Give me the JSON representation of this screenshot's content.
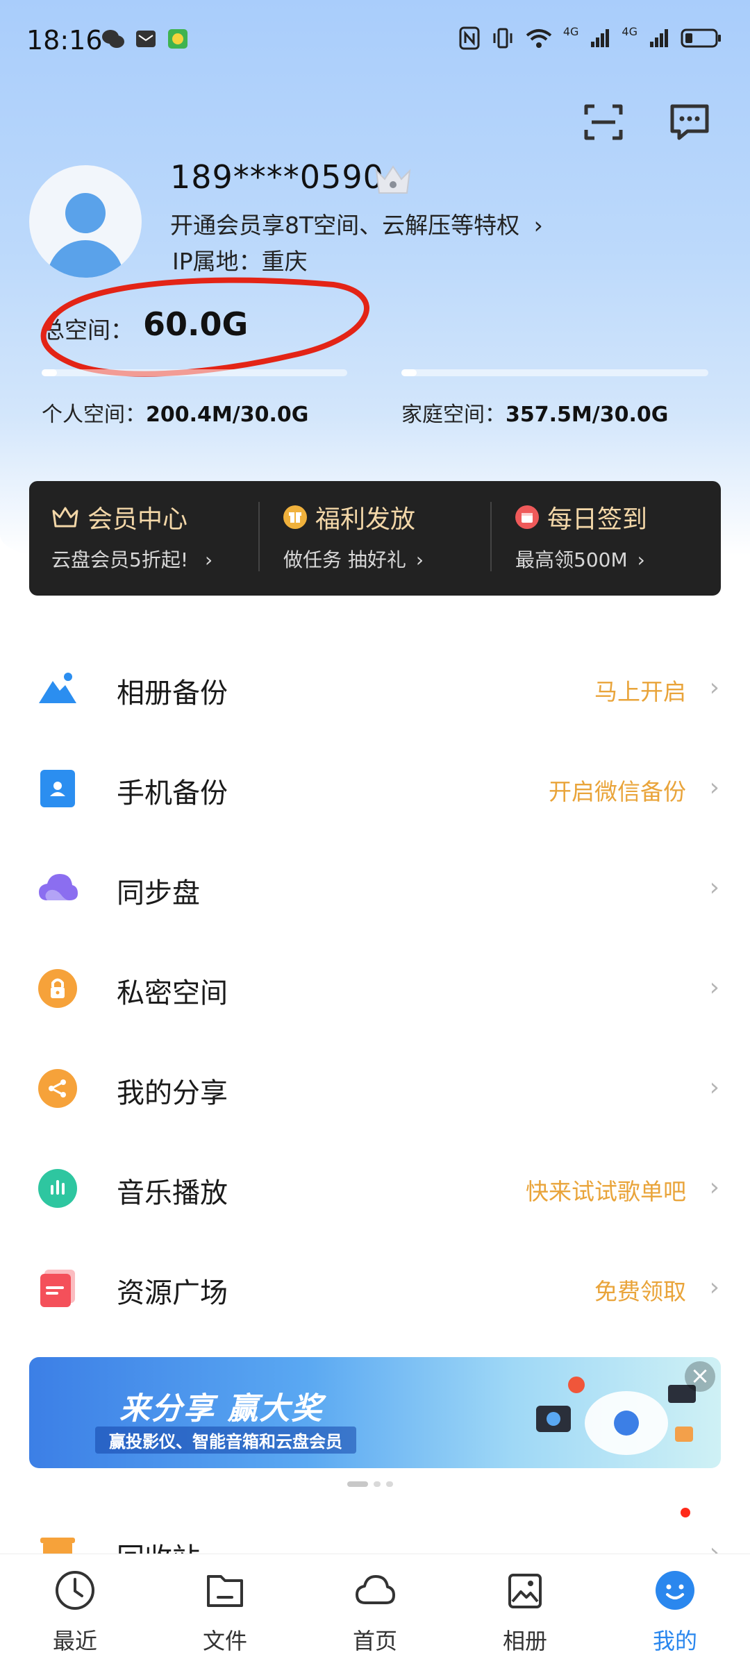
{
  "status_bar": {
    "time": "18:16",
    "net1": "4G",
    "net2": "4G"
  },
  "profile": {
    "phone": "189****0590",
    "promo": "开通会员享8T空间、云解压等特权",
    "promo_chevron": "›",
    "ip_location": "IP属地：重庆",
    "total_label": "总空间：",
    "total_value": "60.0G"
  },
  "storage": {
    "personal_label": "个人空间：",
    "personal_value": "200.4M/30.0G",
    "personal_fraction": 0.0065,
    "family_label": "家庭空间：",
    "family_value": "357.5M/30.0G",
    "family_fraction": 0.0116
  },
  "vip_card": {
    "items": [
      {
        "title": "会员中心",
        "sub": "云盘会员5折起!",
        "icon": "crown-icon"
      },
      {
        "title": "福利发放",
        "sub": "做任务 抽好礼",
        "icon": "gift-icon"
      },
      {
        "title": "每日签到",
        "sub": "最高领500M",
        "icon": "calendar-icon"
      }
    ],
    "chevron": "›"
  },
  "menu": [
    {
      "label": "相册备份",
      "extra": "马上开启",
      "icon": "mountain-icon",
      "color": "#2b8ef0"
    },
    {
      "label": "手机备份",
      "extra": "开启微信备份",
      "icon": "contact-icon",
      "color": "#2b8ef0"
    },
    {
      "label": "同步盘",
      "extra": "",
      "icon": "cloud-icon",
      "color": "#8b6ef0"
    },
    {
      "label": "私密空间",
      "extra": "",
      "icon": "lock-icon",
      "color": "#f6a23a"
    },
    {
      "label": "我的分享",
      "extra": "",
      "icon": "share-icon",
      "color": "#f6a23a"
    },
    {
      "label": "音乐播放",
      "extra": "快来试试歌单吧",
      "icon": "music-bars-icon",
      "color": "#2ec6a0"
    },
    {
      "label": "资源广场",
      "extra": "免费领取",
      "icon": "resource-icon",
      "color": "#f4505a"
    },
    {
      "label": "回收站",
      "extra": "",
      "icon": "recycle-icon",
      "color": "#f6a23a"
    }
  ],
  "menu_chevron": "›",
  "banner": {
    "title": "来分享 赢大奖",
    "subtitle": "赢投影仪、智能音箱和云盘会员",
    "close": "×"
  },
  "bottom_nav": [
    {
      "label": "最近",
      "icon": "clock-icon"
    },
    {
      "label": "文件",
      "icon": "folder-icon"
    },
    {
      "label": "首页",
      "icon": "cloud-home-icon"
    },
    {
      "label": "相册",
      "icon": "photo-icon"
    },
    {
      "label": "我的",
      "icon": "smile-icon",
      "active": true
    }
  ],
  "colors": {
    "accent": "#2a87ee",
    "extra_text": "#e9a43a",
    "vip_gold": "#f3d7a8",
    "annotation_red": "#e32416"
  }
}
